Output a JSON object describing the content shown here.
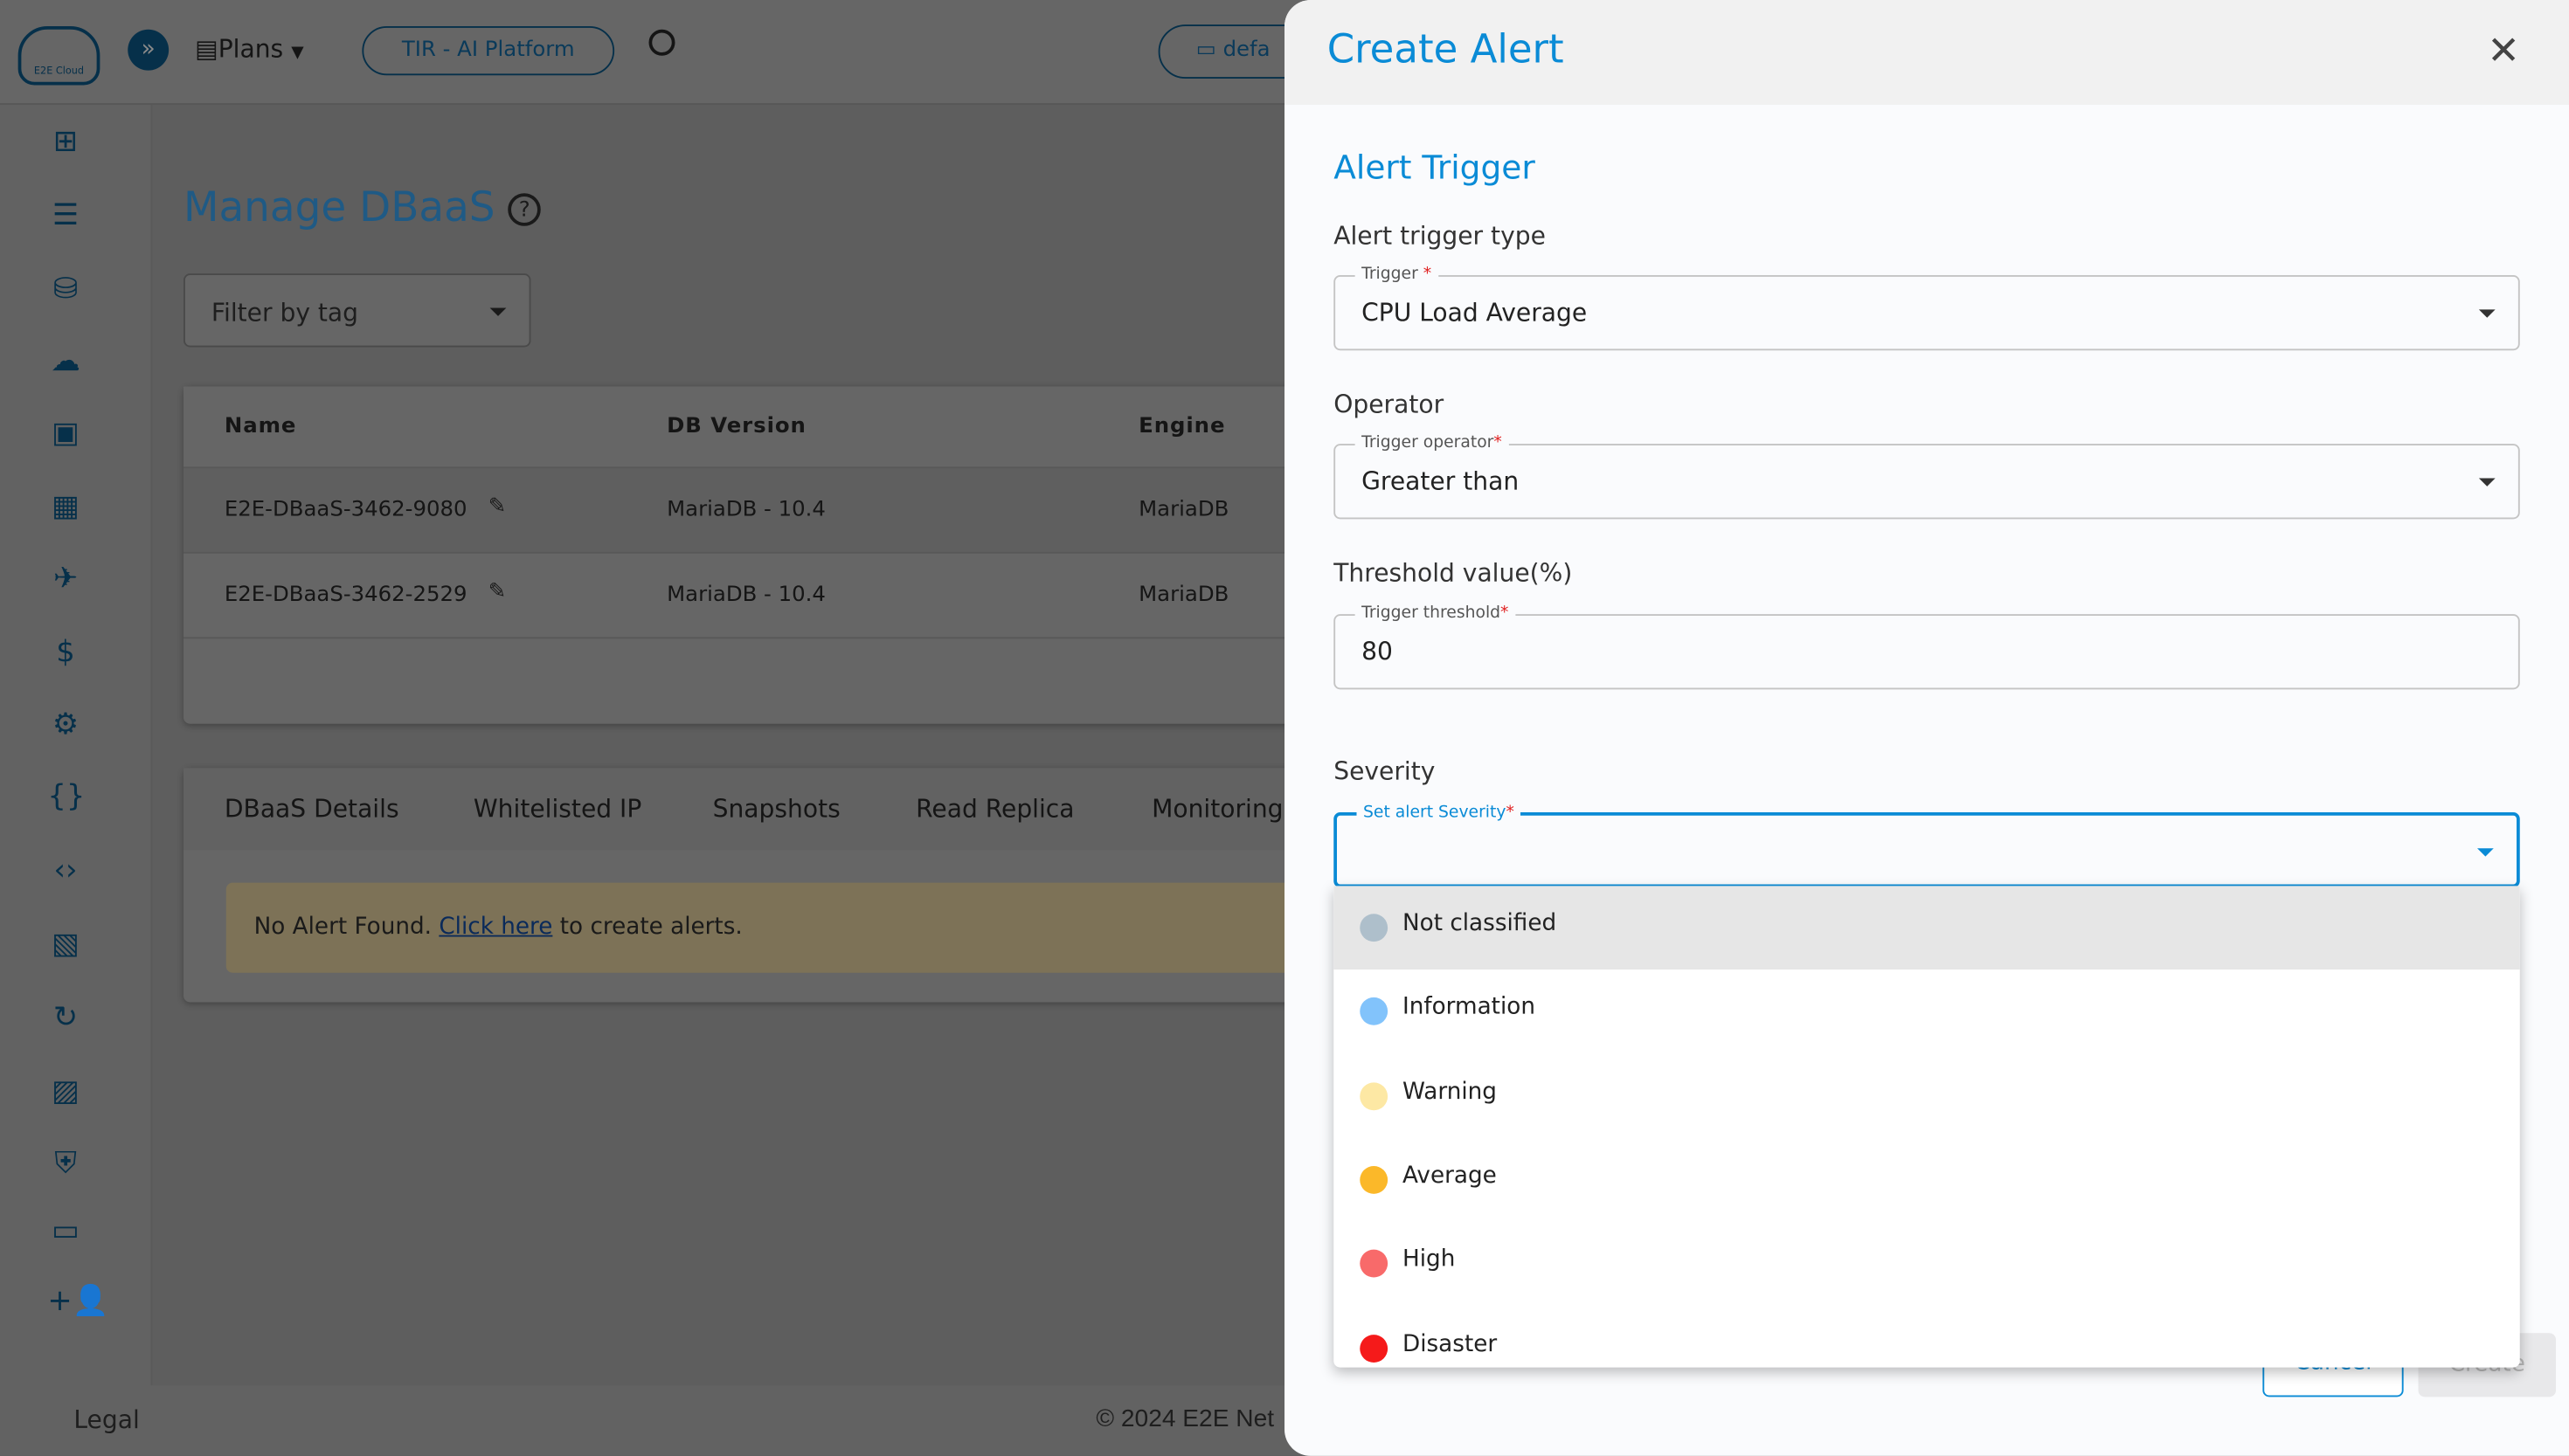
{
  "topbar": {
    "plans_label": "Plans",
    "tir_button": "TIR - AI Platform",
    "project_button": "defa",
    "logo_text": "E2E Cloud"
  },
  "sidebar": {
    "icons": [
      "dashboard-add-icon",
      "server-list-icon",
      "database-icon",
      "cloud-upload-icon",
      "network-server-icon",
      "grid-table-icon",
      "rocket-icon",
      "billing-icon",
      "settings-gear-icon",
      "braces-icon",
      "code-icon",
      "document-image-icon",
      "chat-refresh-icon",
      "broken-image-icon",
      "security-user-icon",
      "monitor-icon",
      "add-user-icon"
    ]
  },
  "main": {
    "title": "Manage DBaaS",
    "filter_placeholder": "Filter by tag",
    "table": {
      "headers": [
        "Name",
        "DB Version",
        "Engine"
      ],
      "rows": [
        [
          "E2E-DBaaS-3462-9080",
          "MariaDB - 10.4",
          "MariaDB"
        ],
        [
          "E2E-DBaaS-3462-2529",
          "MariaDB - 10.4",
          "MariaDB"
        ]
      ]
    },
    "tabs": [
      "DBaaS Details",
      "Whitelisted IP",
      "Snapshots",
      "Read Replica",
      "Monitoring"
    ],
    "alert": {
      "prefix": "No Alert Found. ",
      "link": "Click here",
      "suffix": " to create alerts."
    }
  },
  "footer": {
    "legal": "Legal",
    "copyright": "© 2024 E2E Net"
  },
  "dialog": {
    "title": "Create Alert",
    "section": "Alert Trigger",
    "trigger_type_label": "Alert trigger type",
    "trigger_field_label": "Trigger",
    "trigger_value": "CPU Load Average",
    "operator_label": "Operator",
    "operator_field_label": "Trigger operator",
    "operator_value": "Greater than",
    "threshold_label": "Threshold value(%)",
    "threshold_field_label": "Trigger threshold",
    "threshold_value": "80",
    "severity_label": "Severity",
    "severity_field_label": "Set alert Severity",
    "required_mark": "*",
    "severity_options": [
      {
        "label": "Not classified",
        "color": "#aebfcb"
      },
      {
        "label": "Information",
        "color": "#82c3fb"
      },
      {
        "label": "Warning",
        "color": "#fde8a4"
      },
      {
        "label": "Average",
        "color": "#fbb829"
      },
      {
        "label": "High",
        "color": "#f86a6a"
      },
      {
        "label": "Disaster",
        "color": "#f51a1a"
      }
    ],
    "cancel_label": "Cancel",
    "create_label": "Create"
  },
  "colors": {
    "accent": "#0a8bd6",
    "brand_dark": "#0b4f7c"
  }
}
